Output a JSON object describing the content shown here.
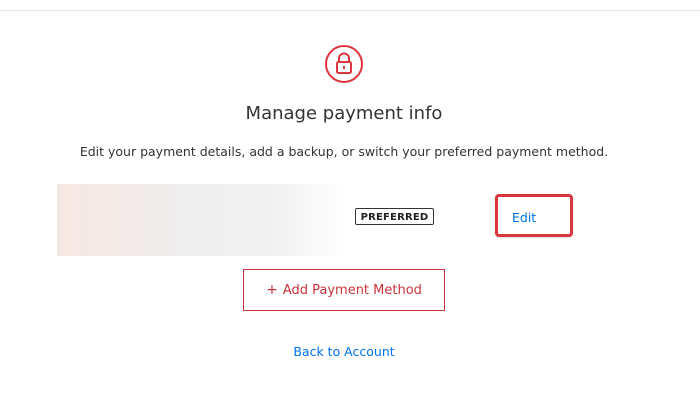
{
  "header": {
    "icon": "lock-icon",
    "title": "Manage payment info",
    "subtitle": "Edit your payment details, add a backup, or switch your preferred payment method."
  },
  "payment_method": {
    "badge": "PREFERRED",
    "edit_label": "Edit"
  },
  "actions": {
    "add_icon": "+",
    "add_label": "Add Payment Method",
    "back_label": "Back to Account"
  },
  "colors": {
    "accent": "#d9363e",
    "link": "#0071eb",
    "text": "#333333"
  }
}
